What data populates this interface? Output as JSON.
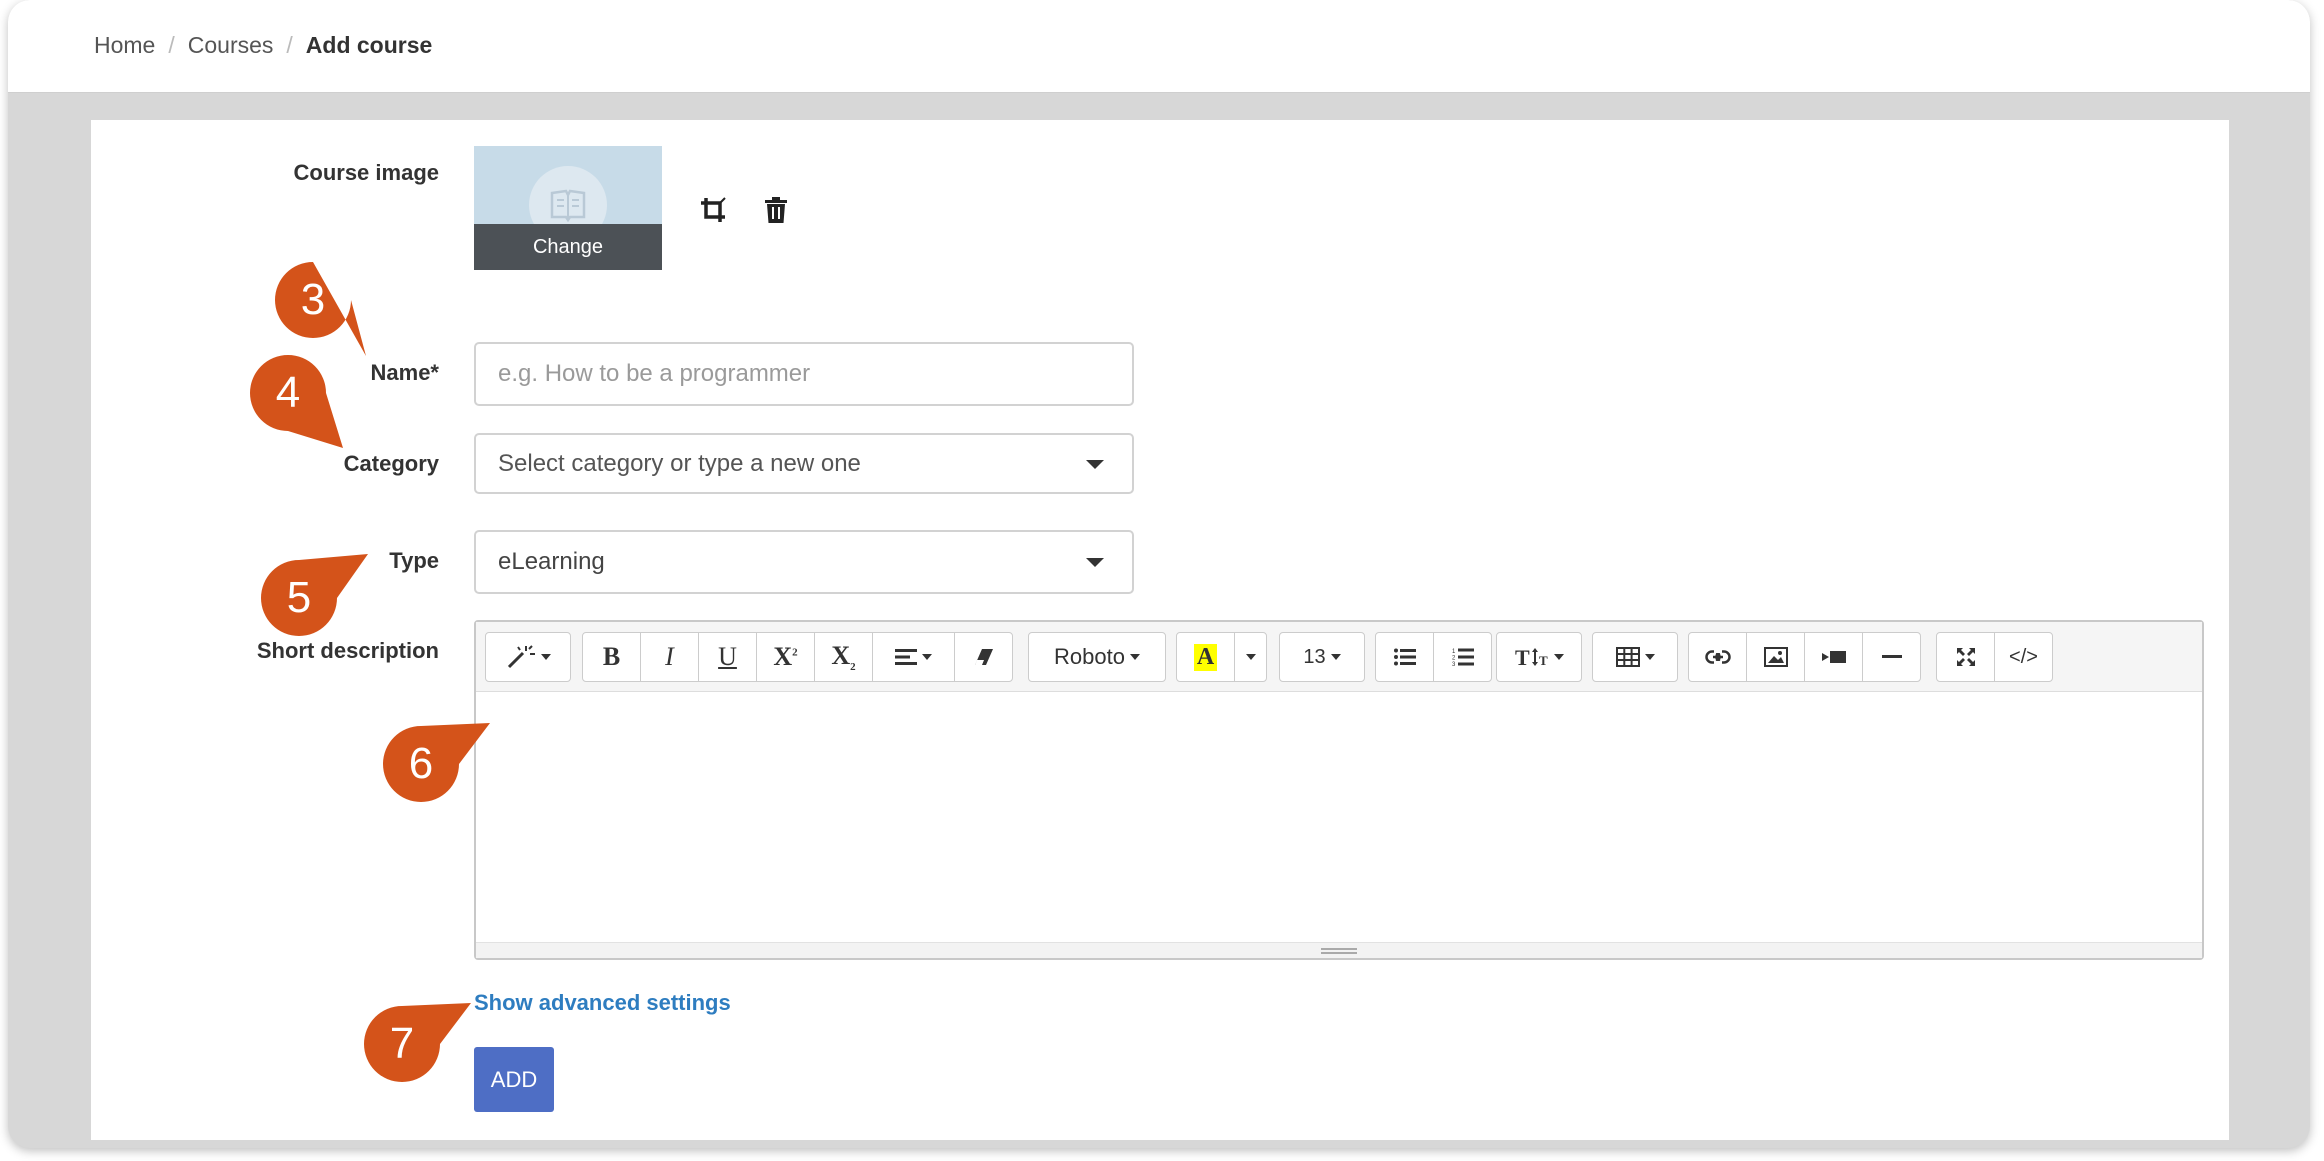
{
  "breadcrumb": {
    "home": "Home",
    "courses": "Courses",
    "current": "Add course",
    "separator": "/"
  },
  "form": {
    "course_image_label": "Course image",
    "change_label": "Change",
    "name_label": "Name*",
    "name_placeholder": "e.g. How to be a programmer",
    "category_label": "Category",
    "category_placeholder": "Select category or type a new one",
    "type_label": "Type",
    "type_value": "eLearning",
    "short_description_label": "Short description",
    "advanced_link": "Show advanced settings",
    "add_button": "ADD"
  },
  "editor_toolbar": {
    "font_name": "Roboto",
    "font_size": "13",
    "bold": "B",
    "italic": "I",
    "underline": "U",
    "highlight": "A",
    "code_view": "</>",
    "buttons": [
      "magic-style",
      "bold",
      "italic",
      "underline",
      "superscript",
      "subscript",
      "paragraph-align",
      "clear-format",
      "font-name",
      "text-color",
      "text-color-menu",
      "font-size",
      "unordered-list",
      "ordered-list",
      "line-height",
      "table",
      "link",
      "image",
      "video",
      "horizontal-rule",
      "fullscreen",
      "code-view"
    ]
  },
  "markers": [
    "3",
    "4",
    "5",
    "6",
    "7"
  ],
  "colors": {
    "accent": "#d4531a",
    "button": "#4e6ec5",
    "link": "#2e7dc0",
    "highlight": "#ffff00"
  }
}
